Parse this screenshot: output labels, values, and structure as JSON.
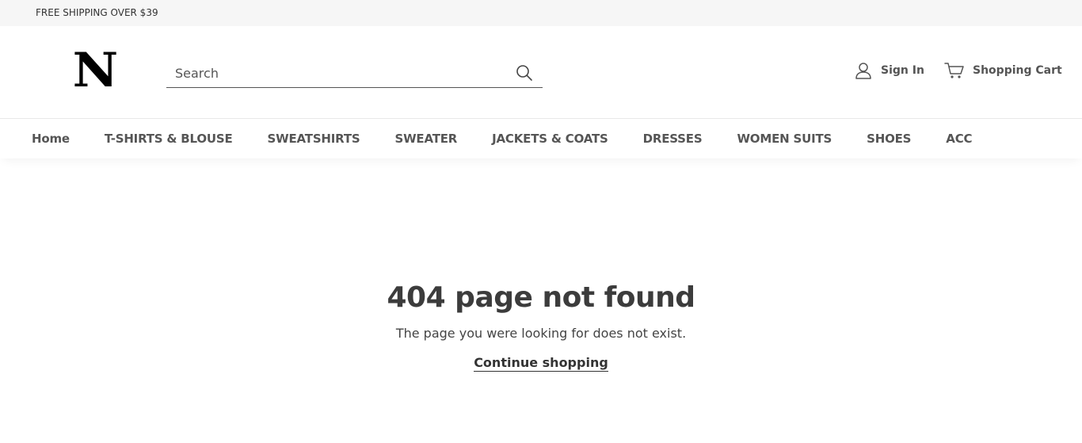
{
  "announcement": {
    "text": "FREE SHIPPING OVER $39"
  },
  "header": {
    "logo_text": "N",
    "search": {
      "placeholder": "Search",
      "value": "",
      "icon": "search-icon"
    },
    "account": {
      "label": "Sign In",
      "icon": "user-icon"
    },
    "cart": {
      "label": "Shopping Cart",
      "icon": "cart-icon"
    }
  },
  "nav": {
    "items": [
      {
        "label": "Home"
      },
      {
        "label": "T-SHIRTS & BLOUSE"
      },
      {
        "label": "SWEATSHIRTS"
      },
      {
        "label": "SWEATER"
      },
      {
        "label": "JACKETS & COATS"
      },
      {
        "label": "DRESSES"
      },
      {
        "label": "WOMEN SUITS"
      },
      {
        "label": "SHOES"
      },
      {
        "label": "ACC"
      }
    ]
  },
  "main": {
    "title": "404 page not found",
    "message": "The page you were looking for does not exist.",
    "link_label": "Continue shopping"
  },
  "colors": {
    "announcement_bg": "#f6f6f6",
    "text": "#3a3a3a",
    "nav_text": "#555555"
  }
}
